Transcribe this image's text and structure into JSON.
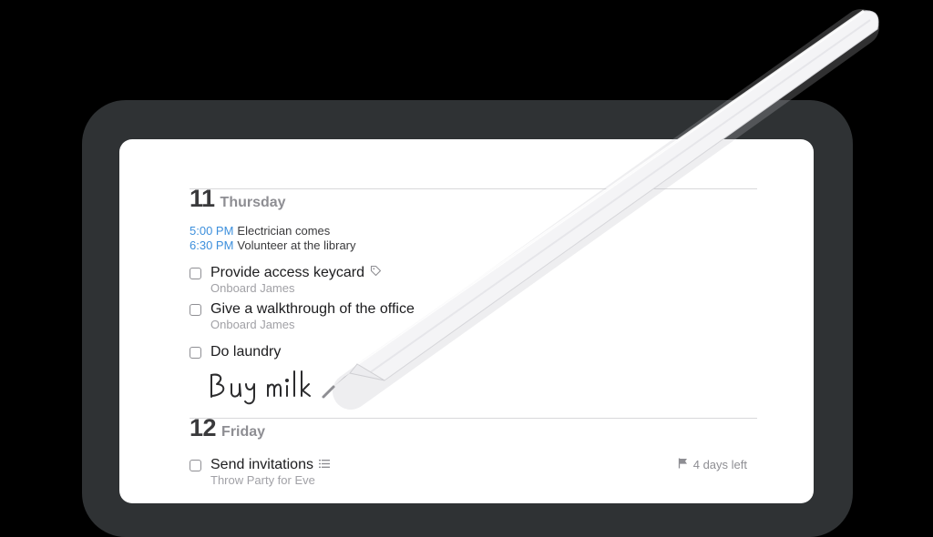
{
  "days": [
    {
      "number": "11",
      "name": "Thursday",
      "events": [
        {
          "time": "5:00 PM",
          "title": "Electrician comes"
        },
        {
          "time": "6:30 PM",
          "title": "Volunteer at the library"
        }
      ],
      "tasks": [
        {
          "title": "Provide access keycard",
          "subtitle": "Onboard James",
          "icon": "tag-icon"
        },
        {
          "title": "Give a walkthrough of the office",
          "subtitle": "Onboard James"
        },
        {
          "title": "Do laundry",
          "subtitle": ""
        }
      ],
      "handwriting": "Buy milk"
    },
    {
      "number": "12",
      "name": "Friday",
      "tasks": [
        {
          "title": "Send invitations",
          "subtitle": "Throw Party for Eve",
          "icon": "list-icon",
          "deadline": "4 days left",
          "deadline_icon": "flag-icon"
        }
      ]
    }
  ],
  "colors": {
    "accent": "#3d8fdc",
    "device_frame": "#2f3234",
    "secondary_text": "#8e8e93"
  }
}
